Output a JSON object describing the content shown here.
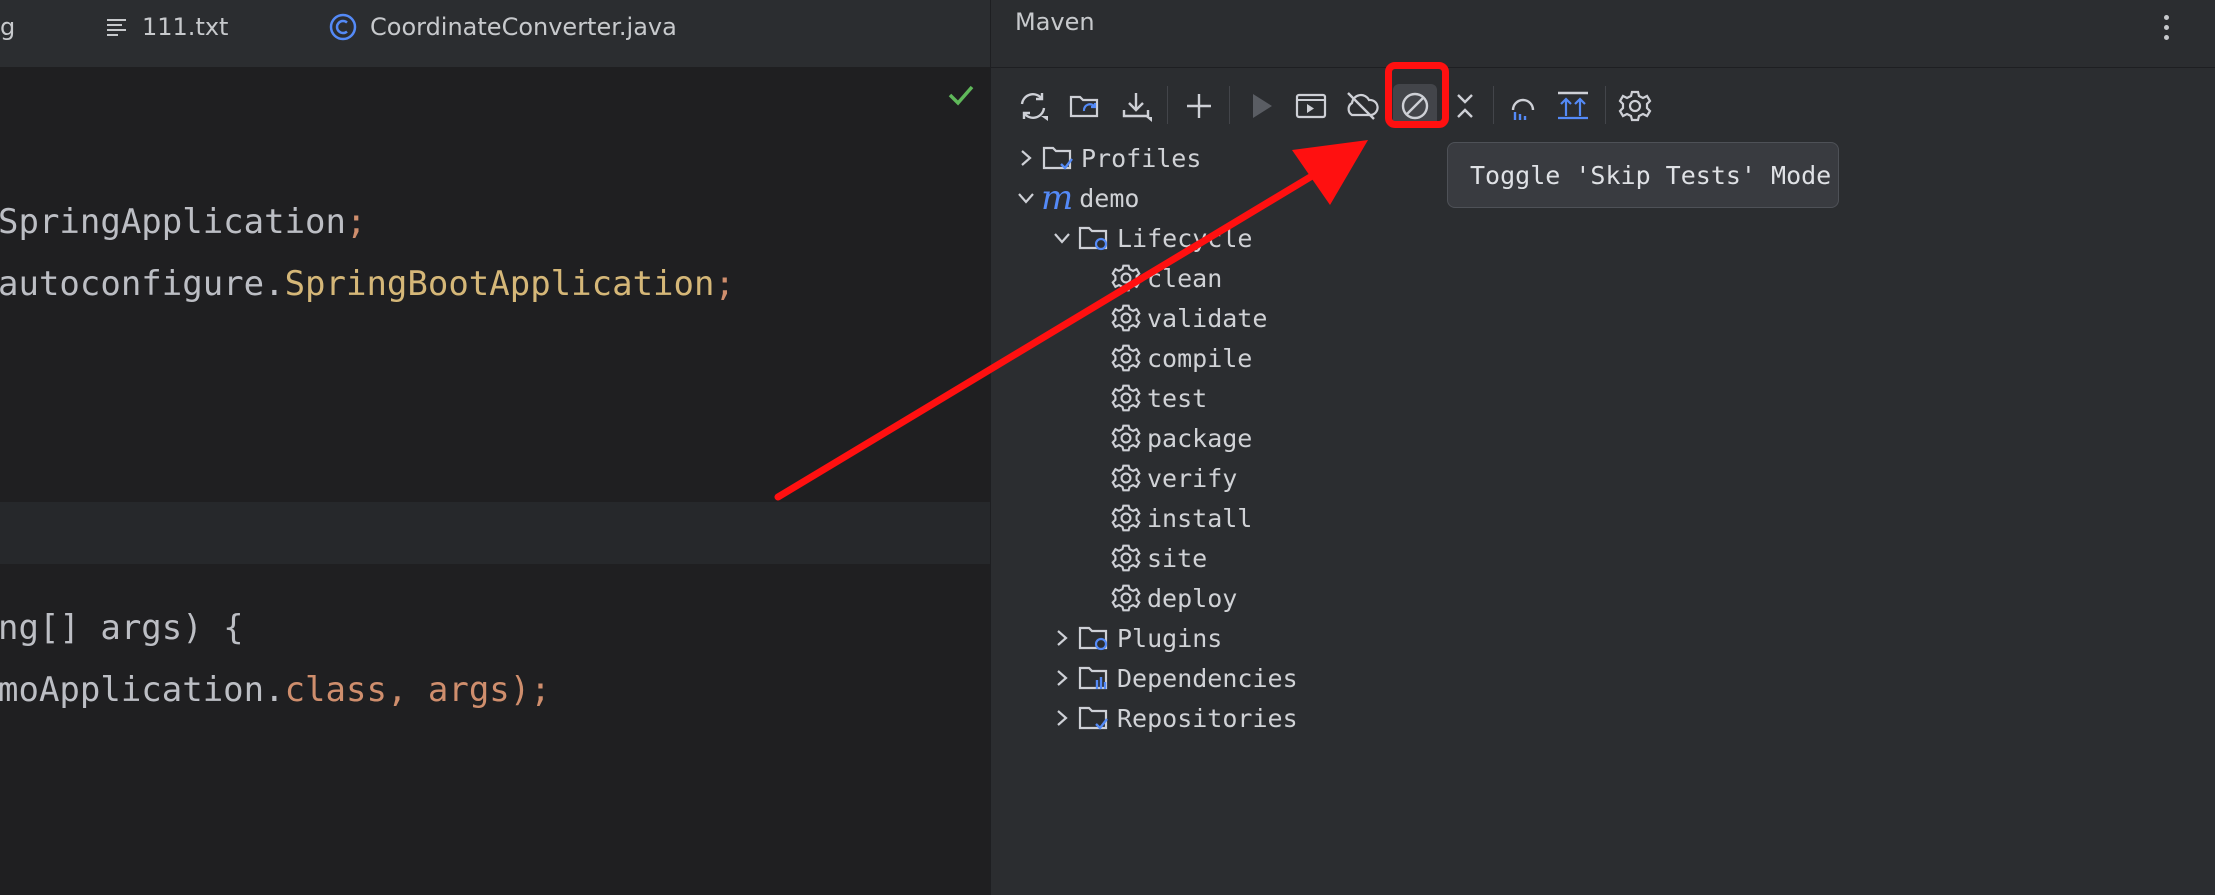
{
  "editor": {
    "tabs": [
      {
        "label": "g",
        "icon": "none"
      },
      {
        "label": "111.txt",
        "icon": "text-file-icon"
      },
      {
        "label": "CoordinateConverter.java",
        "icon": "java-class-icon"
      }
    ],
    "code": {
      "line1_a": "SpringApplication",
      "line1_b": ";",
      "line2_a": "autoconfigure.",
      "line2_b": "SpringBootApplication",
      "line2_c": ";",
      "line3": "ng[] args) {",
      "line4_a": "moApplication.",
      "line4_b": "class",
      "line4_c": ", args);"
    }
  },
  "maven": {
    "title": "Maven",
    "toolbar": [
      {
        "icon": "reload-all-icon"
      },
      {
        "icon": "reload-folder-icon"
      },
      {
        "icon": "download-icon"
      },
      {
        "icon": "add-icon"
      },
      {
        "icon": "run-icon"
      },
      {
        "icon": "execute-goal-icon"
      },
      {
        "icon": "offline-mode-icon"
      },
      {
        "icon": "skip-tests-icon"
      },
      {
        "icon": "collapse-all-icon"
      },
      {
        "icon": "show-dependencies-icon"
      },
      {
        "icon": "collapse-expand-icon"
      },
      {
        "icon": "settings-icon"
      }
    ],
    "tooltip": "Toggle 'Skip Tests' Mode",
    "tree": {
      "profiles": "Profiles",
      "project": "demo",
      "lifecycle": "Lifecycle",
      "goals": [
        "clean",
        "validate",
        "compile",
        "test",
        "package",
        "verify",
        "install",
        "site",
        "deploy"
      ],
      "plugins": "Plugins",
      "dependencies": "Dependencies",
      "repositories": "Repositories"
    }
  },
  "colors": {
    "editor_bg": "#1f1f21",
    "panel_bg": "#2b2d30",
    "keyword": "#cf8e6d",
    "class_ref": "#d5b778",
    "accent_blue": "#548af7",
    "annotation_red": "#ff1010"
  }
}
